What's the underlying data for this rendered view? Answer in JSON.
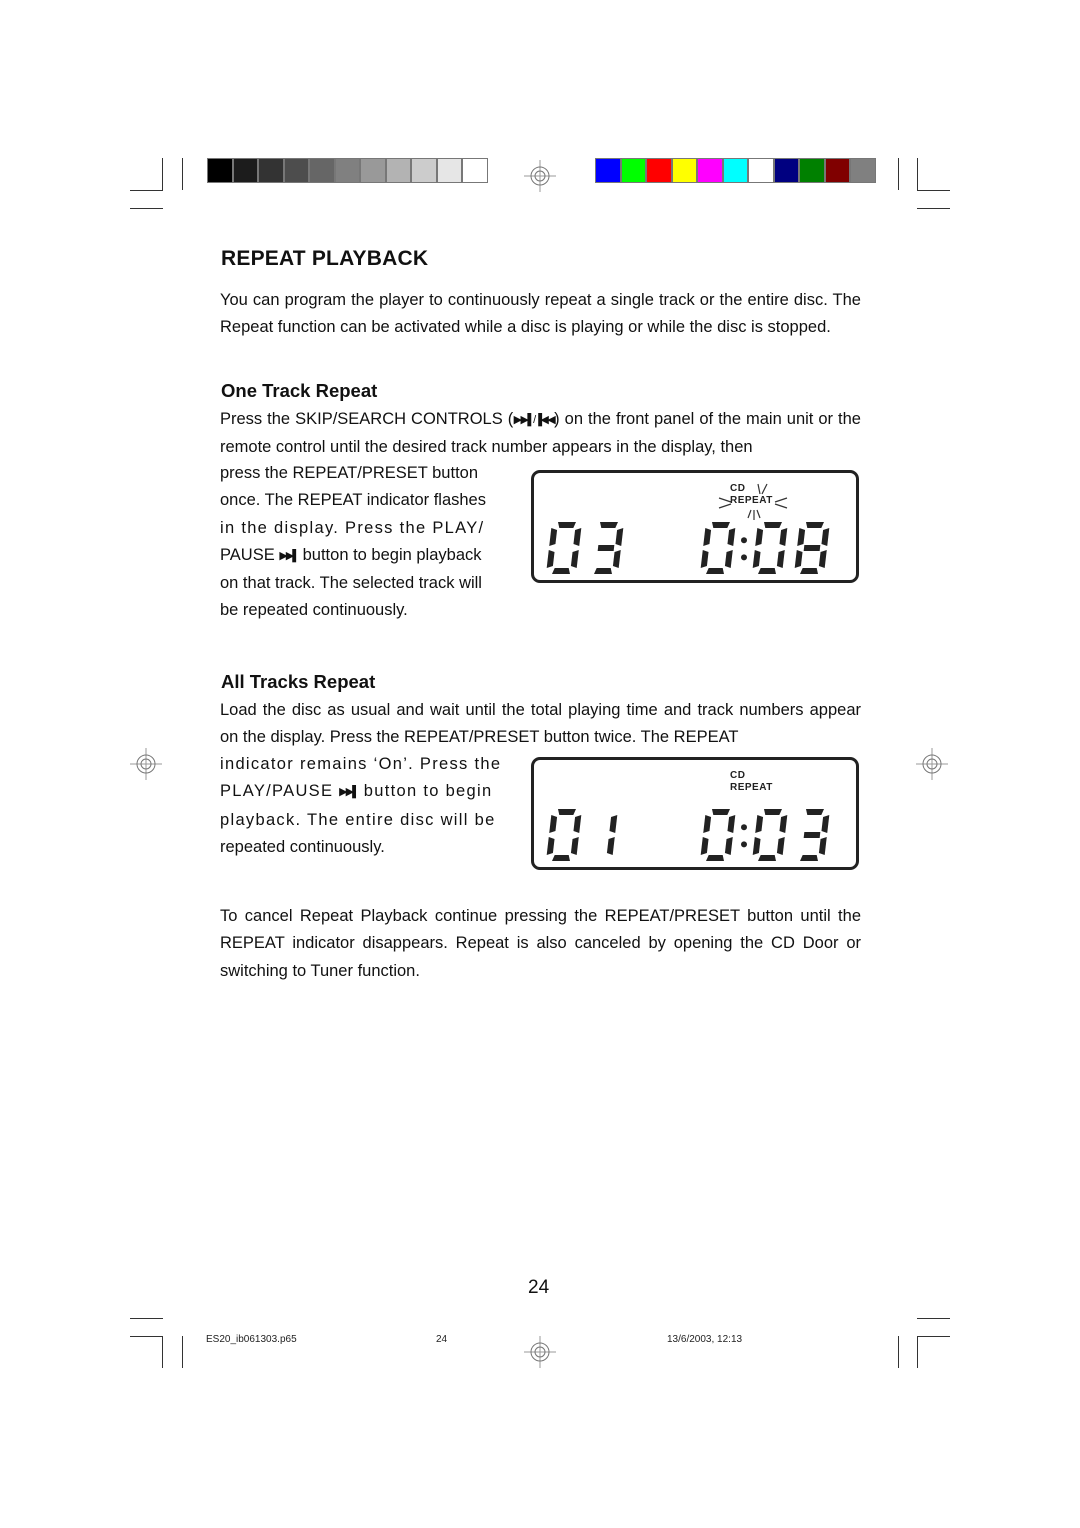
{
  "print_marks": {
    "grayscale_bar": [
      "#000000",
      "#1c1c1c",
      "#333333",
      "#4d4d4d",
      "#666666",
      "#808080",
      "#999999",
      "#b3b3b3",
      "#cccccc",
      "#e6e6e6",
      "#ffffff"
    ],
    "color_bar": [
      "#0000ff",
      "#00ff00",
      "#ff0000",
      "#ffff00",
      "#ff00ff",
      "#00ffff",
      "#ffffff",
      "#000080",
      "#008000",
      "#800000",
      "#808080"
    ]
  },
  "page": {
    "title": "REPEAT PLAYBACK",
    "intro": "You can program the player to continuously repeat a single track or the entire disc. The Repeat function can be activated while a disc is playing or while the disc is stopped.",
    "one_track": {
      "heading": "One Track Repeat",
      "p1_before": "Press the SKIP/SEARCH CONTROLS (",
      "p1_icon": "skip-next/skip-prev",
      "p1_after": ") on the front panel of the main unit or the remote control until the desired track number appears in the display, then",
      "p2_l1": "press the REPEAT/PRESET button",
      "p2_l2": "once. The REPEAT indicator flashes",
      "p2_l3": "in the display. Press the PLAY/",
      "p2_l4a": "PAUSE",
      "p2_l4b": "button to begin playback",
      "p2_l5": "on that track. The selected track will",
      "p2_l6": "be repeated continuously.",
      "display": {
        "indicator_top": "CD",
        "indicator_bottom": "REPEAT",
        "indicator_flashing": true,
        "track": "03",
        "time_min": "0",
        "time_sec": "08"
      }
    },
    "all_tracks": {
      "heading": "All Tracks Repeat",
      "p1": "Load the disc as usual and wait until the total playing time and track numbers appear on the display. Press the REPEAT/PRESET button twice. The REPEAT",
      "p2_l1": "indicator remains ‘On’. Press the",
      "p2_l2a": "PLAY/PAUSE",
      "p2_l2b": "button to begin",
      "p2_l3": "playback. The entire disc will be",
      "p2_l4": "repeated continuously.",
      "display": {
        "indicator_top": "CD",
        "indicator_bottom": "REPEAT",
        "indicator_flashing": false,
        "track": "01",
        "time_min": "0",
        "time_sec": "03"
      }
    },
    "cancel_text": "To cancel Repeat Playback continue pressing the REPEAT/PRESET button until the REPEAT indicator disappears. Repeat is also canceled by opening the CD Door or switching to Tuner function.",
    "page_number": "24"
  },
  "footer": {
    "filename": "ES20_ib061303.p65",
    "page": "24",
    "datetime": "13/6/2003, 12:13"
  }
}
